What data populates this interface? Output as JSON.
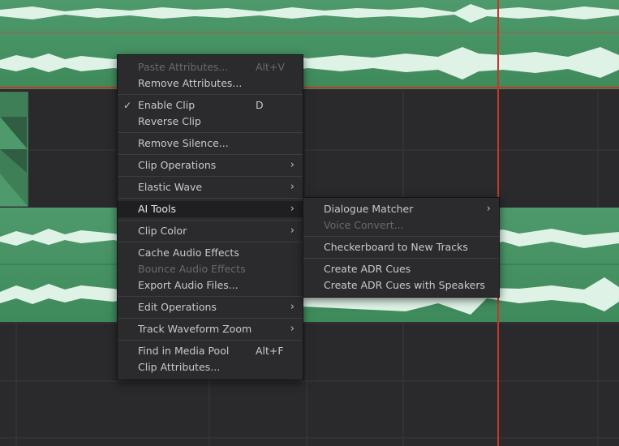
{
  "context_menu": [
    {
      "label": "Paste Attributes...",
      "shortcut": "Alt+V",
      "disabled": true
    },
    {
      "label": "Remove Attributes..."
    },
    {
      "sep": true
    },
    {
      "label": "Enable Clip",
      "shortcut": "D",
      "checked": true
    },
    {
      "label": "Reverse Clip"
    },
    {
      "sep": true
    },
    {
      "label": "Remove Silence..."
    },
    {
      "sep": true
    },
    {
      "label": "Clip Operations",
      "submenu": true
    },
    {
      "sep": true
    },
    {
      "label": "Elastic Wave",
      "submenu": true
    },
    {
      "sep": true
    },
    {
      "label": "AI Tools",
      "submenu": true,
      "highlighted": true
    },
    {
      "sep": true
    },
    {
      "label": "Clip Color",
      "submenu": true
    },
    {
      "sep": true
    },
    {
      "label": "Cache Audio Effects"
    },
    {
      "label": "Bounce Audio Effects",
      "disabled": true
    },
    {
      "label": "Export Audio Files..."
    },
    {
      "sep": true
    },
    {
      "label": "Edit Operations",
      "submenu": true
    },
    {
      "sep": true
    },
    {
      "label": "Track Waveform Zoom",
      "submenu": true
    },
    {
      "sep": true
    },
    {
      "label": "Find in Media Pool",
      "shortcut": "Alt+F"
    },
    {
      "label": "Clip Attributes..."
    }
  ],
  "ai_tools_submenu": [
    {
      "label": "Dialogue Matcher",
      "submenu": true
    },
    {
      "label": "Voice Convert...",
      "disabled": true
    },
    {
      "sep": true
    },
    {
      "label": "Checkerboard to New Tracks"
    },
    {
      "sep": true
    },
    {
      "label": "Create ADR Cues"
    },
    {
      "label": "Create ADR Cues with Speakers"
    }
  ],
  "icons": {
    "check": "✓",
    "chevron": "›"
  },
  "colors": {
    "clip": "#4f9a6c",
    "waveform": "#dff2e6",
    "playhead": "#c0392b"
  }
}
